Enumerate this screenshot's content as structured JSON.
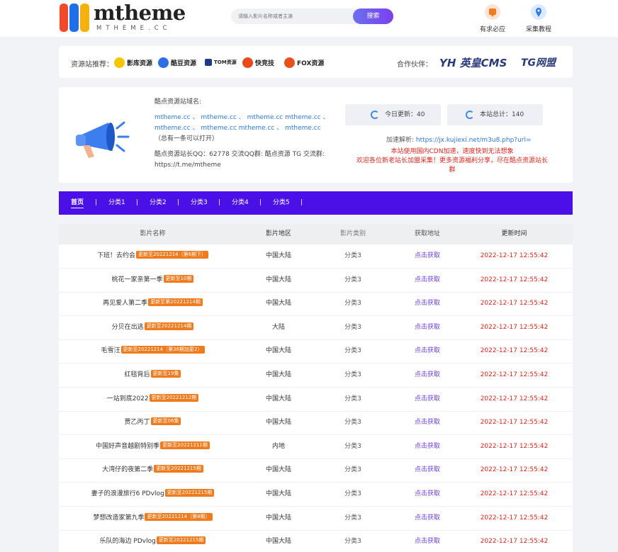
{
  "header": {
    "logo_text": "mtheme",
    "logo_sub": "MTHEME.CC",
    "search_placeholder": "请输入影片名称或者主演",
    "search_button": "搜索",
    "links": [
      {
        "label": "有求必应",
        "icon": "request-icon"
      },
      {
        "label": "采集教程",
        "icon": "tutorial-icon"
      }
    ]
  },
  "partners": {
    "label": "资源站推荐：",
    "items": [
      "影库资源",
      "酷豆资源",
      "TOM资源",
      "快竞技",
      "FOX资源"
    ],
    "collab_label": "合作伙伴：",
    "collab_items": [
      "英皇CMS",
      "TG网盟"
    ],
    "collab_prefix": "YH"
  },
  "info": {
    "domain_title": "酷点资源站域名:",
    "domains": "mtheme.cc 、 mtheme.cc 、 mtheme.cc mtheme.cc 、 mtheme.cc 、 mtheme.cc mtheme.cc 、 mtheme.cc",
    "domains_note": "（总有一条可以打开）",
    "contact": "酷点资源站长QQ：62778 交流QQ群: 酷点资源 TG 交流群: https://t.me/mtheme",
    "today_label": "今日更新：40",
    "total_label": "本站总计：140",
    "parse_label": "加速解析:",
    "parse_url": "https://jx.kujiexi.net/m3u8.php?url=",
    "notice_1": "本站使用国内CDN加速，速度快到无法想象",
    "notice_2": "欢迎各位新老站长加盟采集！更多资源福利分享，尽在酷点资源站长群"
  },
  "nav": {
    "items": [
      "首页",
      "分类1",
      "分类2",
      "分类3",
      "分类4",
      "分类5"
    ],
    "separator": "|"
  },
  "table": {
    "headers": [
      "影片名称",
      "影片地区",
      "影片类别",
      "获取地址",
      "更新时间"
    ],
    "rows": [
      {
        "name": "下班！去约会",
        "badge": "更新至20221214（第6期下）",
        "region": "中国大陆",
        "category": "分类3",
        "link": "点击获取",
        "time": "2022-12-17 12:55:42"
      },
      {
        "name": "桃花一家亲第一季",
        "badge": "更新至10期",
        "region": "中国大陆",
        "category": "分类3",
        "link": "点击获取",
        "time": "2022-12-17 12:55:42"
      },
      {
        "name": "再见爱人第二季",
        "badge": "更新至第20221214期",
        "region": "中国大陆",
        "category": "分类3",
        "link": "点击获取",
        "time": "2022-12-17 12:55:42"
      },
      {
        "name": "分贝在出逃",
        "badge": "更新至20221214期",
        "region": "大陆",
        "category": "分类3",
        "link": "点击获取",
        "time": "2022-12-17 12:55:42"
      },
      {
        "name": "毛雪汪",
        "badge": "更新至20221214（第36期加更2）",
        "region": "中国大陆",
        "category": "分类3",
        "link": "点击获取",
        "time": "2022-12-17 12:55:42"
      },
      {
        "name": "红毯背后",
        "badge": "更新至19集",
        "region": "中国大陆",
        "category": "分类3",
        "link": "点击获取",
        "time": "2022-12-17 12:55:42"
      },
      {
        "name": "一站到底2022",
        "badge": "更新至20221212期",
        "region": "中国大陆",
        "category": "分类3",
        "link": "点击获取",
        "time": "2022-12-17 12:55:42"
      },
      {
        "name": "贾乙丙丁",
        "badge": "更新至06集",
        "region": "中国大陆",
        "category": "分类3",
        "link": "点击获取",
        "time": "2022-12-17 12:55:42"
      },
      {
        "name": "中国好声音越剧特别季",
        "badge": "更新至20221211期",
        "region": "内地",
        "category": "分类3",
        "link": "点击获取",
        "time": "2022-12-17 12:55:42"
      },
      {
        "name": "大湾仔的夜第二季",
        "badge": "更新至20221215期",
        "region": "中国大陆",
        "category": "分类3",
        "link": "点击获取",
        "time": "2022-12-17 12:55:42"
      },
      {
        "name": "妻子的浪漫旅行6 PDvlog",
        "badge": "更新至20221215期",
        "region": "中国大陆",
        "category": "分类3",
        "link": "点击获取",
        "time": "2022-12-17 12:55:42"
      },
      {
        "name": "梦想改造家第九季",
        "badge": "更新至20221214（第8期）",
        "region": "中国大陆",
        "category": "分类3",
        "link": "点击获取",
        "time": "2022-12-17 12:55:42"
      },
      {
        "name": "乐队的海边 PDvlog",
        "badge": "更新至20221215期",
        "region": "中国大陆",
        "category": "分类3",
        "link": "点击获取",
        "time": "2022-12-17 12:55:42"
      }
    ]
  },
  "colors": {
    "accent": "#4b10e8",
    "badge": "#f07a1c",
    "time": "#e2231a",
    "link": "#6a3de8"
  }
}
